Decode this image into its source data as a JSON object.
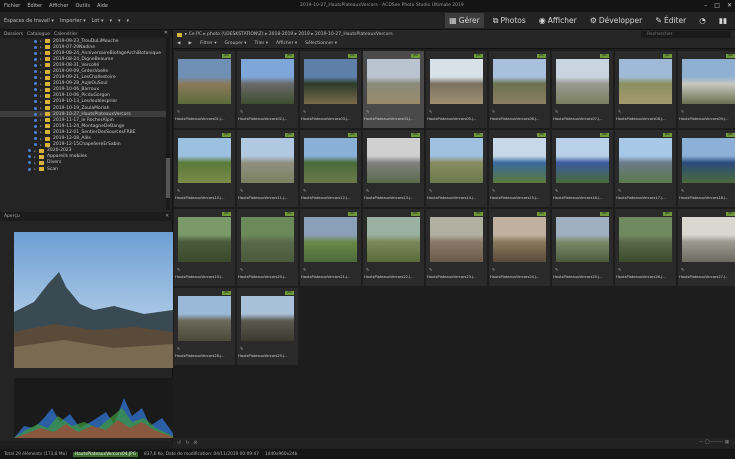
{
  "menu": [
    "Fichier",
    "Éditer",
    "Afficher",
    "Outils",
    "Aide"
  ],
  "app_title": "2019-10-27_HautsPlateauxVercors - ACDSee Photo Studio Ultimate 2019",
  "toolbar_tools": [
    "Espaces de travail ▾",
    "Importer ▾",
    "Lot ▾",
    "▾",
    "▾",
    "▾"
  ],
  "modes": [
    {
      "label": "Gérer",
      "icon": "grid-icon",
      "active": true
    },
    {
      "label": "Photos",
      "icon": "photos-icon",
      "active": false
    },
    {
      "label": "Afficher",
      "icon": "eye-icon",
      "active": false
    },
    {
      "label": "Développer",
      "icon": "develop-icon",
      "active": false
    },
    {
      "label": "Éditer",
      "icon": "edit-icon",
      "active": false
    }
  ],
  "left_tabs": [
    "Dossiers",
    "Catalogue",
    "Calendrier"
  ],
  "tree": [
    {
      "label": "2019-09-23_TrouDuLiMouche",
      "sel": false,
      "icon": "folder"
    },
    {
      "label": "2019-07-29Nadine",
      "sel": false,
      "icon": "folder"
    },
    {
      "label": "2019-08-24_AnniversaireBiofageArchiBotanique",
      "sel": false,
      "icon": "folder"
    },
    {
      "label": "2019-08-24_DigneBeaume",
      "sel": false,
      "icon": "folder"
    },
    {
      "label": "2019-08-31_Vercollé",
      "sel": false,
      "icon": "folder"
    },
    {
      "label": "2019-09-09_GrdesVoelle",
      "sel": false,
      "icon": "folder"
    },
    {
      "label": "2019-09-21_LesChallestoire",
      "sel": false,
      "icon": "folder"
    },
    {
      "label": "2019-09-28_AuJeOuSoul",
      "sel": false,
      "icon": "folder"
    },
    {
      "label": "2019-10-06_Barroux",
      "sel": false,
      "icon": "folder"
    },
    {
      "label": "2019-10-06_PicduGorgon",
      "sel": false,
      "icon": "folder"
    },
    {
      "label": "2019-10-13_Lesdoublesprior",
      "sel": false,
      "icon": "folder"
    },
    {
      "label": "2019-10-19_ZoulaMoriah",
      "sel": false,
      "icon": "folder"
    },
    {
      "label": "2019-10-27_HautsPlateauxVercors",
      "sel": true,
      "icon": "folder"
    },
    {
      "label": "2019-11-17_le RocherAlpin",
      "sel": false,
      "icon": "folder"
    },
    {
      "label": "2019-11-24_MontagneDeBange",
      "sel": false,
      "icon": "folder"
    },
    {
      "label": "2019-12-01_SentierDesSourcesFRBE",
      "sel": false,
      "icon": "folder"
    },
    {
      "label": "2019-12-08_Alès",
      "sel": false,
      "icon": "folder"
    },
    {
      "label": "2019-12-15ChapeliereErSabin",
      "sel": false,
      "icon": "folder"
    },
    {
      "label": "2020-2023",
      "sel": false,
      "icon": "folder"
    },
    {
      "label": "Appareils mobiles",
      "sel": false,
      "icon": "folder"
    },
    {
      "label": "Divers",
      "sel": false,
      "icon": "folder"
    },
    {
      "label": "Scan",
      "sel": false,
      "icon": "folder"
    }
  ],
  "preview_header": "Aperçu",
  "breadcrumb": "▸ Ce PC ▸ photo (\\\\DESKSTATION\\Z) ▸ 2018-2019 ▸ 2019 ▸ 2019-10-27_HautsPlateauxVercors",
  "search_placeholder": "Rechercher",
  "filter_items": [
    "Filtrer ▾",
    "Grouper ▾",
    "Trier ▾",
    "Afficher ▾",
    "Sélectionner ▾"
  ],
  "thumb_badge": "JPG",
  "captions": [
    "HautsPlateauxVercors01.J...",
    "HautsPlateauxVercors02.J...",
    "HautsPlateauxVercors03.J...",
    "HautsPlateauxVercors04.J...",
    "HautsPlateauxVercors05.J...",
    "HautsPlateauxVercors06.J...",
    "HautsPlateauxVercors07.J...",
    "HautsPlateauxVercors08.J...",
    "HautsPlateauxVercors09.J...",
    "HautsPlateauxVercors10.J...",
    "HautsPlateauxVercors11.J...",
    "HautsPlateauxVercors12.J...",
    "HautsPlateauxVercors13.J...",
    "HautsPlateauxVercors14.J...",
    "HautsPlateauxVercors15.J...",
    "HautsPlateauxVercors16.J...",
    "HautsPlateauxVercors17.J...",
    "HautsPlateauxVercors18.J...",
    "HautsPlateauxVercors19.J...",
    "HautsPlateauxVercors20.J...",
    "HautsPlateauxVercors21.J...",
    "HautsPlateauxVercors22.J...",
    "HautsPlateauxVercors23.J...",
    "HautsPlateauxVercors24.J...",
    "HautsPlateauxVercors25.J...",
    "HautsPlateauxVercors26.J...",
    "HautsPlateauxVercors27.J...",
    "HautsPlateauxVercors28.J...",
    "HautsPlateauxVercors29.J..."
  ],
  "status": {
    "total": "Total 29 éléments (173,8 Mo)",
    "file": "HautsPlateauxVercors04.JPG",
    "info": "837,6 Ko, Date de modification: 04/11/2019 00:09:47",
    "dims": "1440x960x24b"
  },
  "colors": {
    "accent": "#4a7fd6",
    "folder": "#d8b23a",
    "badge": "#6f9a3a"
  }
}
